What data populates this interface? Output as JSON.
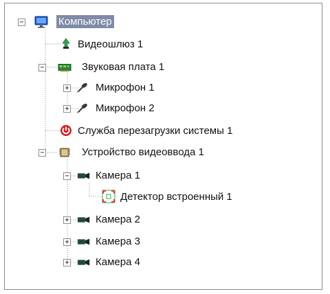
{
  "tree": {
    "root": {
      "label": "Компьютер",
      "icon": "monitor-icon",
      "expanded": true,
      "selected": true
    },
    "items": [
      {
        "label": "Видеошлюз 1",
        "icon": "video-gateway-icon"
      },
      {
        "label": "Звуковая плата 1",
        "icon": "sound-card-icon",
        "expanded": true,
        "children": [
          {
            "label": "Микрофон 1",
            "icon": "microphone-icon",
            "expanded": false
          },
          {
            "label": "Микрофон 2",
            "icon": "microphone-icon",
            "expanded": false
          }
        ]
      },
      {
        "label": "Служба перезагрузки системы 1",
        "icon": "power-icon",
        "icon_color": "#e01b1b"
      },
      {
        "label": "Устройство видеоввода 1",
        "icon": "chip-icon",
        "expanded": true,
        "children": [
          {
            "label": "Камера 1",
            "icon": "camera-icon",
            "expanded": true,
            "children": [
              {
                "label": "Детектор встроенный 1",
                "icon": "detector-icon"
              }
            ]
          },
          {
            "label": "Камера 2",
            "icon": "camera-icon",
            "expanded": false
          },
          {
            "label": "Камера 3",
            "icon": "camera-icon",
            "expanded": false
          },
          {
            "label": "Камера 4",
            "icon": "camera-icon",
            "expanded": false
          }
        ]
      }
    ]
  },
  "colors": {
    "selection": "#7f8aa8",
    "connector": "#8a8a8a",
    "power": "#e01b1b",
    "detector": "#24b24a"
  }
}
